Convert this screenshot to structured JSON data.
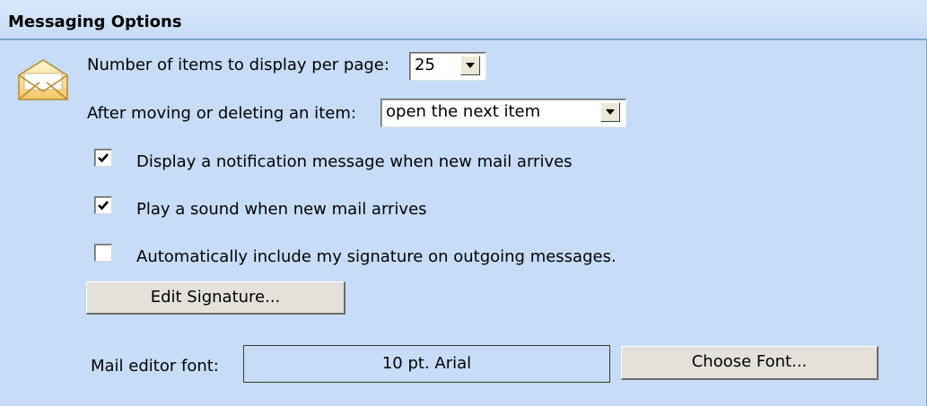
{
  "header": {
    "title": "Messaging Options"
  },
  "items_per_page": {
    "label": "Number of items to display per page:",
    "value": "25"
  },
  "after_move": {
    "label": "After moving or deleting an item:",
    "value": "open the next item"
  },
  "options": [
    {
      "label": "Display a notification message when new mail arrives",
      "checked": true
    },
    {
      "label": "Play a sound when new mail arrives",
      "checked": true
    },
    {
      "label": "Automatically include my signature on outgoing messages.",
      "checked": false
    }
  ],
  "edit_signature": {
    "label": "Edit Signature..."
  },
  "mail_font": {
    "label": "Mail editor font:",
    "value": "10 pt. Arial",
    "choose_label": "Choose Font..."
  },
  "icons": {
    "messaging": "envelope-icon",
    "dropdown": "chevron-down-icon",
    "check": "checkmark-icon"
  }
}
